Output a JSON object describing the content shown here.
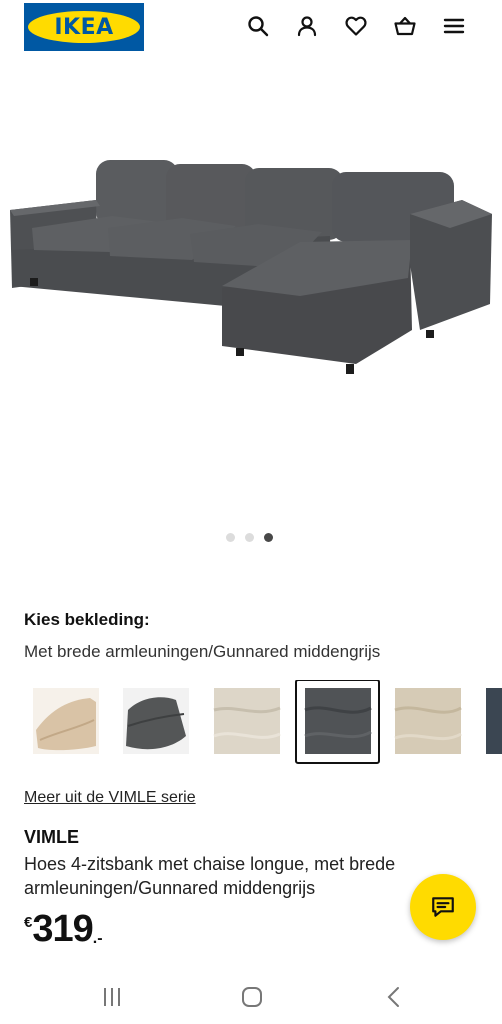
{
  "header": {
    "logo_text": "IKEA",
    "icons": [
      "search-icon",
      "user-icon",
      "heart-icon",
      "basket-icon",
      "menu-icon"
    ]
  },
  "gallery": {
    "image_count": 3,
    "active_index": 2
  },
  "options": {
    "heading": "Kies bekleding:",
    "selected_variant": "Met brede armleuningen/Gunnared middengrijs",
    "swatches": [
      {
        "name": "beige",
        "color": "#d9c3a6"
      },
      {
        "name": "dark-grey",
        "color": "#545657"
      },
      {
        "name": "light-beige",
        "color": "#ddd6c8"
      },
      {
        "name": "gunnared-medium-grey",
        "color": "#505356",
        "selected": true
      },
      {
        "name": "beige-linen",
        "color": "#d6cbb6"
      },
      {
        "name": "dark-blue",
        "color": "#3b4652"
      }
    ]
  },
  "series_link": "Meer uit de VIMLE serie",
  "product": {
    "name": "VIMLE",
    "description": "Hoes 4-zitsbank met chaise longue, met brede armleuningen/Gunnared middengrijs",
    "price_currency": "€",
    "price_amount": "319",
    "price_decimal": ".-"
  },
  "colors": {
    "ikea_blue": "#0058a3",
    "ikea_yellow": "#ffdb00"
  },
  "system_nav": [
    "recent-apps-icon",
    "home-icon",
    "back-icon"
  ]
}
